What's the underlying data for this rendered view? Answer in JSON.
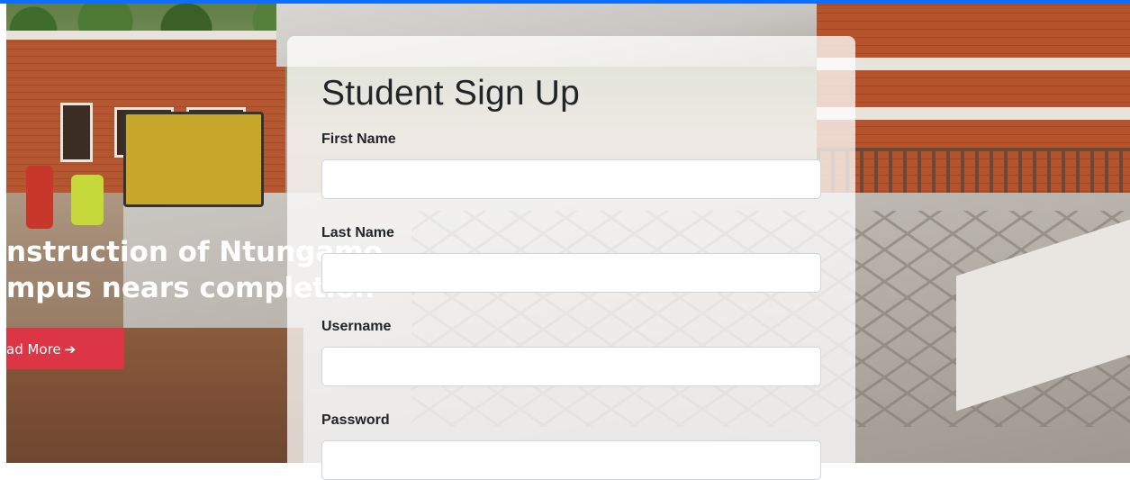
{
  "hero": {
    "headline_line1": "nstruction of Ntungamo",
    "headline_line2": "mpus nears completion",
    "read_more_label": "ad More",
    "read_more_arrow": "➔"
  },
  "form": {
    "title": "Student Sign Up",
    "fields": [
      {
        "label": "First Name",
        "value": "",
        "placeholder": ""
      },
      {
        "label": "Last Name",
        "value": "",
        "placeholder": ""
      },
      {
        "label": "Username",
        "value": "",
        "placeholder": ""
      },
      {
        "label": "Password",
        "value": "",
        "placeholder": ""
      }
    ]
  },
  "colors": {
    "top_bar": "#0d6efd",
    "read_more_button": "#dc3545",
    "card_background": "rgba(255,255,255,0.76)"
  }
}
